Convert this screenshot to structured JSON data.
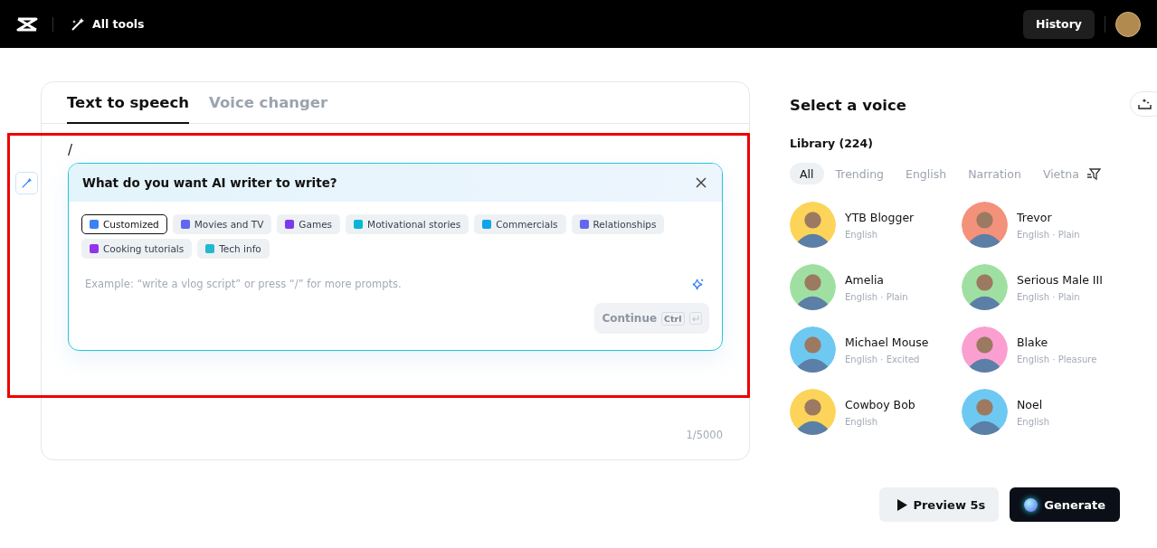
{
  "header": {
    "tools_label": "All tools",
    "history_button": "History"
  },
  "editor": {
    "tabs": [
      {
        "label": "Text to speech",
        "selected": true
      },
      {
        "label": "Voice changer",
        "selected": false
      }
    ],
    "text": "/",
    "ai_writer": {
      "title": "What do you want AI writer to write?",
      "chips": [
        {
          "label": "Customized",
          "selected": true,
          "color": "#3b82f6"
        },
        {
          "label": "Movies and TV",
          "selected": false,
          "color": "#6366f1"
        },
        {
          "label": "Games",
          "selected": false,
          "color": "#7c3aed"
        },
        {
          "label": "Motivational stories",
          "selected": false,
          "color": "#06b6d4"
        },
        {
          "label": "Commercials",
          "selected": false,
          "color": "#0ea5e9"
        },
        {
          "label": "Relationships",
          "selected": false,
          "color": "#6366f1"
        },
        {
          "label": "Cooking tutorials",
          "selected": false,
          "color": "#9333ea"
        },
        {
          "label": "Tech info",
          "selected": false,
          "color": "#22b8cf"
        }
      ],
      "placeholder": "Example: “write a vlog script” or press “/” for more prompts.",
      "continue_button": {
        "label": "Continue",
        "shortcut": "Ctrl",
        "disabled": true
      }
    },
    "counter": "1/5000"
  },
  "voices": {
    "title": "Select a voice",
    "library": "Library (224)",
    "filters": [
      {
        "label": "All",
        "selected": true
      },
      {
        "label": "Trending",
        "selected": false
      },
      {
        "label": "English",
        "selected": false
      },
      {
        "label": "Narration",
        "selected": false
      },
      {
        "label": "Vietna",
        "selected": false
      }
    ],
    "items": [
      {
        "name": "YTB Blogger",
        "detail": "English",
        "color": "#fcd45a"
      },
      {
        "name": "Trevor",
        "detail": "English · Plain",
        "color": "#f4917b"
      },
      {
        "name": "Amelia",
        "detail": "English · Plain",
        "color": "#9fe0a2"
      },
      {
        "name": "Serious Male III",
        "detail": "English · Plain",
        "color": "#9fe0a2"
      },
      {
        "name": "Michael Mouse",
        "detail": "English · Excited",
        "color": "#6ec9f2"
      },
      {
        "name": "Blake",
        "detail": "English · Pleasure",
        "color": "#fb9fd0"
      },
      {
        "name": "Cowboy Bob",
        "detail": "English",
        "color": "#fcd45a"
      },
      {
        "name": "Noel",
        "detail": "English",
        "color": "#6ec9f2"
      }
    ]
  },
  "actions": {
    "preview_button": "Preview 5s",
    "generate_button": "Generate"
  }
}
